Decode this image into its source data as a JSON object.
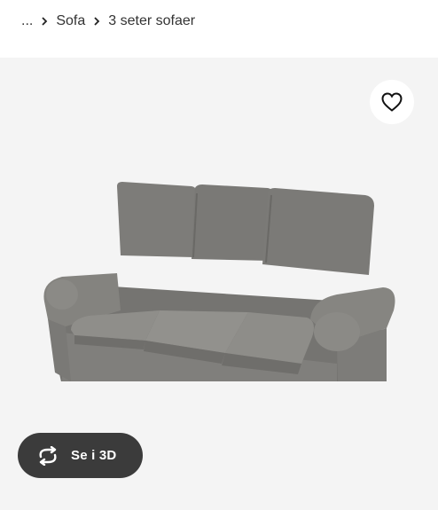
{
  "breadcrumb": {
    "ellipsis": "...",
    "items": [
      "Sofa",
      "3 seter sofaer"
    ]
  },
  "product_image": {
    "alt": "grey three-seat sofa",
    "favorite_icon": "heart-outline-icon",
    "view_3d_label": "Se i 3D",
    "view_3d_icon": "rotate-arrows-icon"
  },
  "colors": {
    "background": "#f4f4f4",
    "pill": "#3b3b3b",
    "sofa": "#7b7a77"
  }
}
